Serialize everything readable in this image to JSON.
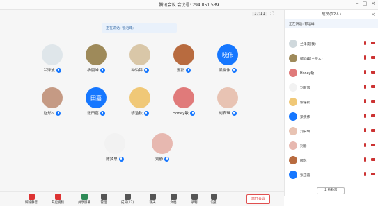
{
  "window": {
    "title": "腾讯会议 会议号: 294 051 539"
  },
  "topbar": {
    "timer": "17:11"
  },
  "speaking": {
    "label": "正在讲话: 郁滔峰;"
  },
  "participants": [
    {
      "name": "兰泽波",
      "initials": "",
      "color": "#dfe6ea"
    },
    {
      "name": "杨丽峰",
      "initials": "",
      "color": "#9e8a5a"
    },
    {
      "name": "钟泊锦",
      "initials": "",
      "color": "#d9c7a8"
    },
    {
      "name": "邢彭",
      "initials": "",
      "color": "#b86b3f"
    },
    {
      "name": "梁晓伟",
      "initials": "晓伟",
      "color": "#1677ff"
    },
    {
      "name": "赵彤~",
      "initials": "",
      "color": "#c59a84"
    },
    {
      "name": "张田嘉",
      "initials": "田嘉",
      "color": "#1677ff"
    },
    {
      "name": "黎浩钦",
      "initials": "",
      "color": "#f0c877"
    },
    {
      "name": "Honey敏",
      "initials": "",
      "color": "#e07a7a"
    },
    {
      "name": "刘安琪",
      "initials": "",
      "color": "#e8c3b3"
    },
    {
      "name": "陈梦思",
      "initials": "",
      "color": "#f2f2f2"
    },
    {
      "name": "刘静",
      "initials": "",
      "color": "#e7b8b0"
    }
  ],
  "toolbar": {
    "items": [
      "解除静音",
      "开启视频",
      "共享屏幕",
      "管理",
      "成员(12)",
      "聊天",
      "文档",
      "录制",
      "设置"
    ],
    "end_label": "离开会议"
  },
  "sidebar": {
    "title": "成员(12人)",
    "speaking": "正在讲话: 郁滔峰;",
    "members": [
      {
        "name": "兰泽波(我)",
        "color": "#cfd8dc"
      },
      {
        "name": "郁滔峰(主持人)",
        "color": "#9e8a5a"
      },
      {
        "name": "Honey敏",
        "color": "#e07a7a"
      },
      {
        "name": "刘梦思",
        "color": "#f2f2f2"
      },
      {
        "name": "黎浩钦",
        "color": "#f0c877"
      },
      {
        "name": "梁晓伟",
        "color": "#1677ff"
      },
      {
        "name": "刘安琪",
        "color": "#e8c3b3"
      },
      {
        "name": "刘静",
        "color": "#e7b8b0"
      },
      {
        "name": "邢彭",
        "color": "#b86b3f"
      },
      {
        "name": "张田嘉",
        "color": "#1677ff"
      }
    ],
    "button": "全员静音"
  }
}
